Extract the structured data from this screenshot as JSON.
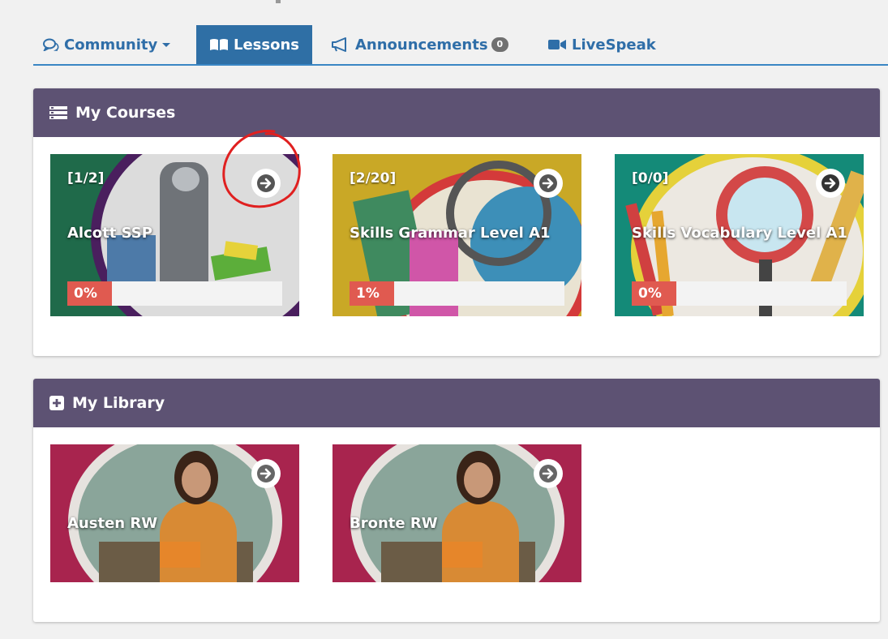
{
  "tabs": [
    {
      "label": "Community",
      "icon": "comments-icon",
      "has_caret": true
    },
    {
      "label": "Lessons",
      "icon": "book-icon",
      "active": true
    },
    {
      "label": "Announcements",
      "icon": "megaphone-icon",
      "badge": "0"
    },
    {
      "label": "LiveSpeak",
      "icon": "video-camera-icon"
    }
  ],
  "my_courses": {
    "title": "My Courses",
    "icon": "list-icon",
    "courses": [
      {
        "count": "[1/2]",
        "title": "Alcott SSP",
        "progress_label": "0%",
        "progress": 0,
        "color": "#1f6a4a"
      },
      {
        "count": "[2/20]",
        "title": "Skills Grammar Level A1",
        "progress_label": "1%",
        "progress": 1,
        "color": "#c9a826"
      },
      {
        "count": "[0/0]",
        "title": "Skills Vocabulary Level A1",
        "progress_label": "0%",
        "progress": 0,
        "color": "#148a78"
      }
    ]
  },
  "my_library": {
    "title": "My Library",
    "icon": "plus-square-icon",
    "items": [
      {
        "title": "Austen RW",
        "color": "#a8244e"
      },
      {
        "title": "Bronte RW",
        "color": "#a8244e"
      }
    ]
  },
  "colors": {
    "header_bg": "#5d5273",
    "tab_active": "#2f6fa5",
    "progress_fill": "#e05a50",
    "annotation_circle": "#e02020"
  }
}
